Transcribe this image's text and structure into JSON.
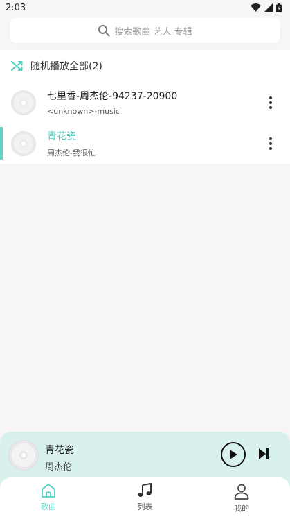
{
  "status_bar": {
    "time": "2:03"
  },
  "search": {
    "placeholder": "搜索歌曲 艺人 专辑"
  },
  "shuffle": {
    "label": "随机播放全部(2)"
  },
  "songs": [
    {
      "title": "七里香-周杰伦-94237-20900",
      "subtitle": "<unknown>-music",
      "active": false
    },
    {
      "title": "青花瓷",
      "subtitle": "周杰伦-我很忙",
      "active": true
    }
  ],
  "player": {
    "title": "青花瓷",
    "artist": "周杰伦"
  },
  "nav": [
    {
      "label": "歌曲",
      "icon": "home-icon",
      "active": true
    },
    {
      "label": "列表",
      "icon": "music-note-icon",
      "active": false
    },
    {
      "label": "我的",
      "icon": "person-icon",
      "active": false
    }
  ],
  "colors": {
    "accent": "#4fcfc0",
    "player_bg": "#d9f1ec",
    "page_bg": "#f7f5f6"
  }
}
